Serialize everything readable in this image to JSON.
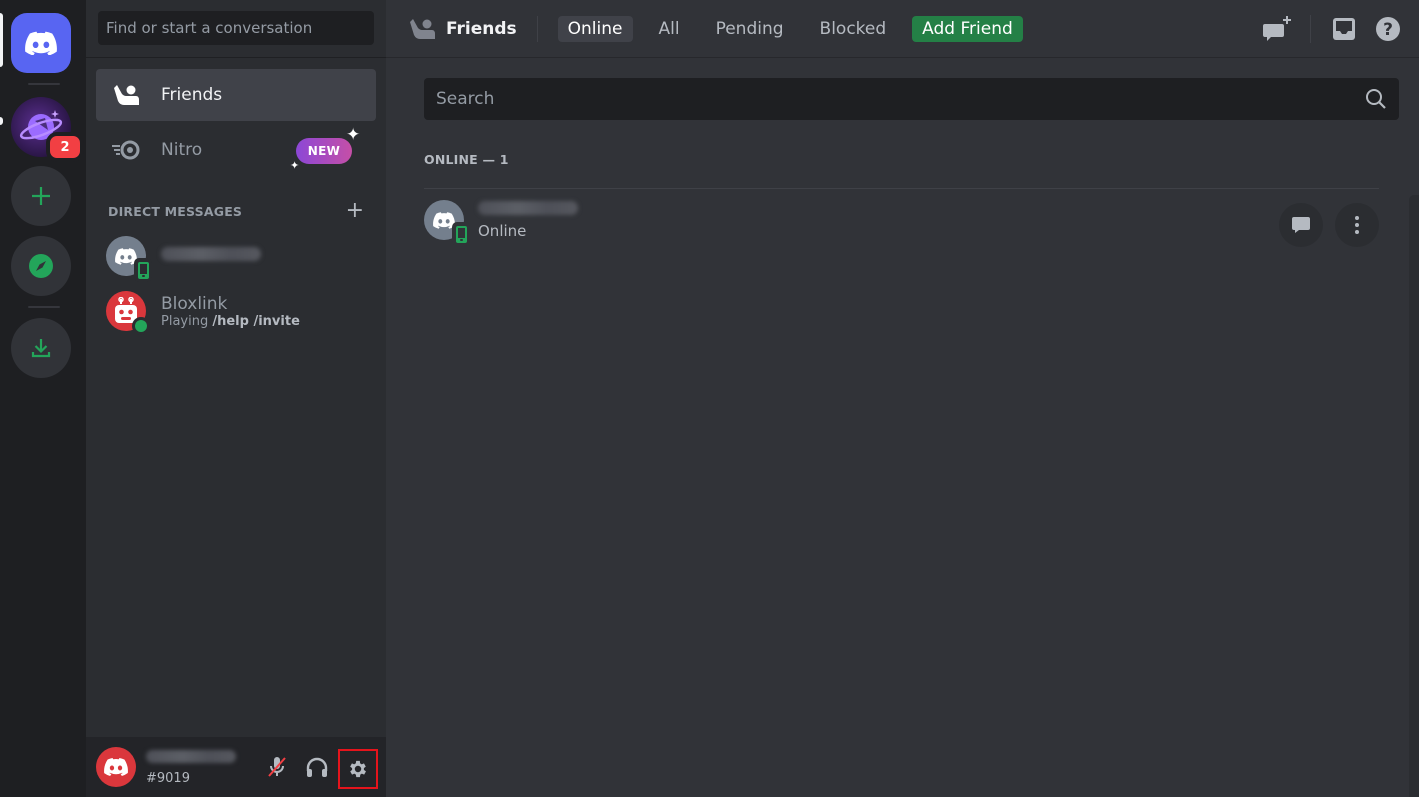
{
  "server_rail": {
    "items": [
      {
        "name": "Home",
        "icon": "discord-logo-icon"
      },
      {
        "name": "Planet server",
        "icon": "planet-server-icon",
        "badge": "2"
      },
      {
        "name": "Add a Server",
        "icon": "plus-icon"
      },
      {
        "name": "Explore Discoverable Servers",
        "icon": "compass-icon"
      },
      {
        "name": "Download Apps",
        "icon": "download-icon"
      }
    ]
  },
  "sidebar": {
    "search_placeholder": "Find or start a conversation",
    "nav": [
      {
        "label": "Friends",
        "icon": "friends-icon",
        "active": true
      },
      {
        "label": "Nitro",
        "icon": "nitro-icon",
        "badge": "NEW"
      }
    ],
    "direct_messages_header": "DIRECT MESSAGES",
    "direct_messages": [
      {
        "name": "[redacted]",
        "status": "mobile-online",
        "activity": ""
      },
      {
        "name": "Bloxlink",
        "status": "online",
        "activity_prefix": "Playing ",
        "activity": "/help /invite"
      }
    ],
    "user_panel": {
      "username": "[redacted]",
      "discriminator": "#9019",
      "controls": [
        {
          "label": "Unmute",
          "icon": "mic-muted-icon"
        },
        {
          "label": "Deafen",
          "icon": "headphones-icon"
        },
        {
          "label": "User Settings",
          "icon": "gear-icon",
          "highlighted": true
        }
      ]
    }
  },
  "topbar": {
    "title": "Friends",
    "tabs": [
      {
        "label": "Online",
        "active": true
      },
      {
        "label": "All"
      },
      {
        "label": "Pending"
      },
      {
        "label": "Blocked"
      },
      {
        "label": "Add Friend",
        "style": "green"
      }
    ],
    "right_icons": [
      "new-group-dm-icon",
      "inbox-icon",
      "help-icon"
    ]
  },
  "main": {
    "search_placeholder": "Search",
    "section_header": "ONLINE — 1",
    "friends": [
      {
        "name": "[redacted]",
        "status": "Online",
        "device": "mobile"
      }
    ]
  },
  "colors": {
    "blurple": "#5865f2",
    "green": "#23a55a",
    "add_friend_green": "#248046",
    "red": "#f23f43",
    "highlight_box": "#e5141c"
  }
}
